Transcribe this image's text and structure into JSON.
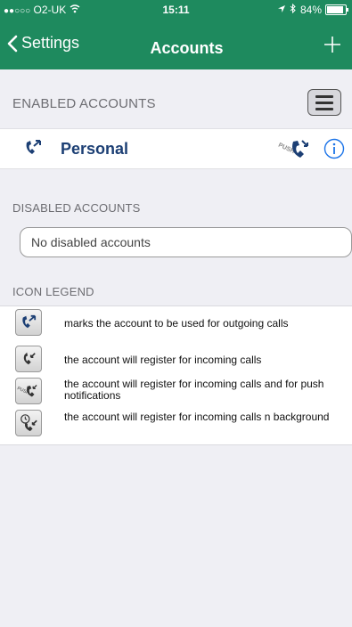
{
  "status_bar": {
    "carrier": "O2-UK",
    "time": "15:11",
    "battery": "84%",
    "battery_level": 0.84
  },
  "nav": {
    "back_label": "Settings",
    "title": "Accounts"
  },
  "enabled_section": {
    "header": "ENABLED ACCOUNTS",
    "accounts": [
      {
        "name": "Personal",
        "icons": [
          "outgoing-call-icon",
          "push-register-icon",
          "info-icon"
        ]
      }
    ]
  },
  "disabled_section": {
    "header": "DISABLED ACCOUNTS",
    "empty_text": "No disabled accounts"
  },
  "legend_section": {
    "header": "ICON LEGEND",
    "items": [
      {
        "icon": "outgoing-call-icon",
        "text": "marks the account to be used for outgoing calls"
      },
      {
        "icon": "incoming-register-icon",
        "text": "the account will register for incoming calls"
      },
      {
        "icon": "push-register-icon",
        "text": "the account will register for incoming calls and for push notifications"
      },
      {
        "icon": "background-register-icon",
        "text": "the account will register for incoming calls n background"
      }
    ]
  },
  "colors": {
    "nav_green": "#1e8a5e",
    "account_blue": "#1c3f74",
    "info_blue": "#1a73e8",
    "background": "#efeff4"
  }
}
